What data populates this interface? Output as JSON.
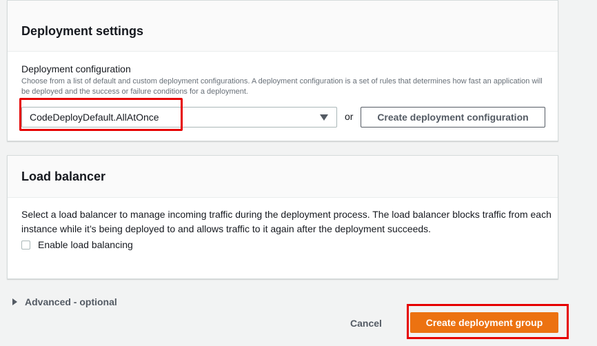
{
  "deployment_settings": {
    "title": "Deployment settings",
    "config_label": "Deployment configuration",
    "config_description": "Choose from a list of default and custom deployment configurations. A deployment configuration is a set of rules that determines how fast an application will be deployed and the success or failure conditions for a deployment.",
    "selected_config": "CodeDeployDefault.AllAtOnce",
    "or_text": "or",
    "create_config_label": "Create deployment configuration"
  },
  "load_balancer": {
    "title": "Load balancer",
    "description": "Select a load balancer to manage incoming traffic during the deployment process. The load balancer blocks traffic from each instance while it’s being deployed to and allows traffic to it again after the deployment succeeds.",
    "checkbox_label": "Enable load balancing",
    "checkbox_checked": false
  },
  "advanced": {
    "label": "Advanced - optional",
    "icon": "caret-right-icon"
  },
  "footer": {
    "cancel_label": "Cancel",
    "submit_label": "Create deployment group"
  },
  "colors": {
    "primary": "#ec7211",
    "highlight": "#e60000",
    "background": "#f2f3f3"
  }
}
